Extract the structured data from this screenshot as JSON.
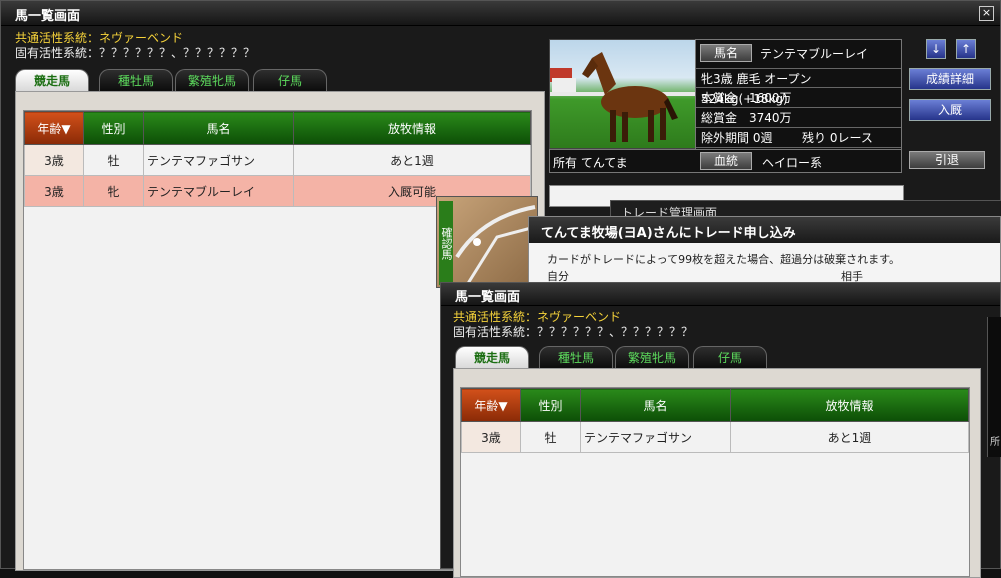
{
  "main": {
    "title": "馬一覧画面",
    "common_label": "共通活性系統：ネヴァーベンド",
    "unique_label": "固有活性系統：？？？？？？、？？？？？？",
    "tabs": [
      "競走馬",
      "種牡馬",
      "繁殖牝馬",
      "仔馬"
    ],
    "columns": [
      "年齢▼",
      "性別",
      "馬名",
      "放牧情報"
    ],
    "rows": [
      {
        "age": "3歳",
        "sex": "牡",
        "name": "テンテマファゴサン",
        "info": "あと1週"
      },
      {
        "age": "3歳",
        "sex": "牝",
        "name": "テンテマブルーレイ",
        "info": "入厩可能"
      }
    ],
    "close_label": "×"
  },
  "detail": {
    "name_btn": "馬名",
    "horse_name": "テンテマブルーレイ",
    "line1": "牝3歳 鹿毛 オープン 524kg(+18kg)",
    "line2": "本賞金　1600万",
    "line3": "総賞金　3740万",
    "line4a": "除外期間 0週",
    "line4b": "残り 0レース",
    "owner": "所有 てんてま",
    "lineage_btn": "血統",
    "lineage": "ヘイロー系",
    "down_icon": "↓",
    "up_icon": "↑",
    "btn_results": "成績詳細",
    "btn_enter": "入厩",
    "btn_retire": "引退"
  },
  "trade": {
    "behind_title": "トレード管理画面",
    "title": "てんてま牧場(ヨA)さんにトレード申し込み",
    "notice": "カードがトレードによって99枚を超えた場合、超過分は破棄されます。",
    "self": "自分",
    "partner": "相手",
    "side_text": "確認馬",
    "edge_char": "所"
  },
  "second": {
    "title": "馬一覧画面",
    "common_label": "共通活性系統：ネヴァーベンド",
    "unique_label": "固有活性系統：？？？？？？、？？？？？？",
    "tabs": [
      "競走馬",
      "種牡馬",
      "繁殖牝馬",
      "仔馬"
    ],
    "columns": [
      "年齢▼",
      "性別",
      "馬名",
      "放牧情報"
    ],
    "rows": [
      {
        "age": "3歳",
        "sex": "牡",
        "name": "テンテマファゴサン",
        "info": "あと1週"
      }
    ]
  }
}
